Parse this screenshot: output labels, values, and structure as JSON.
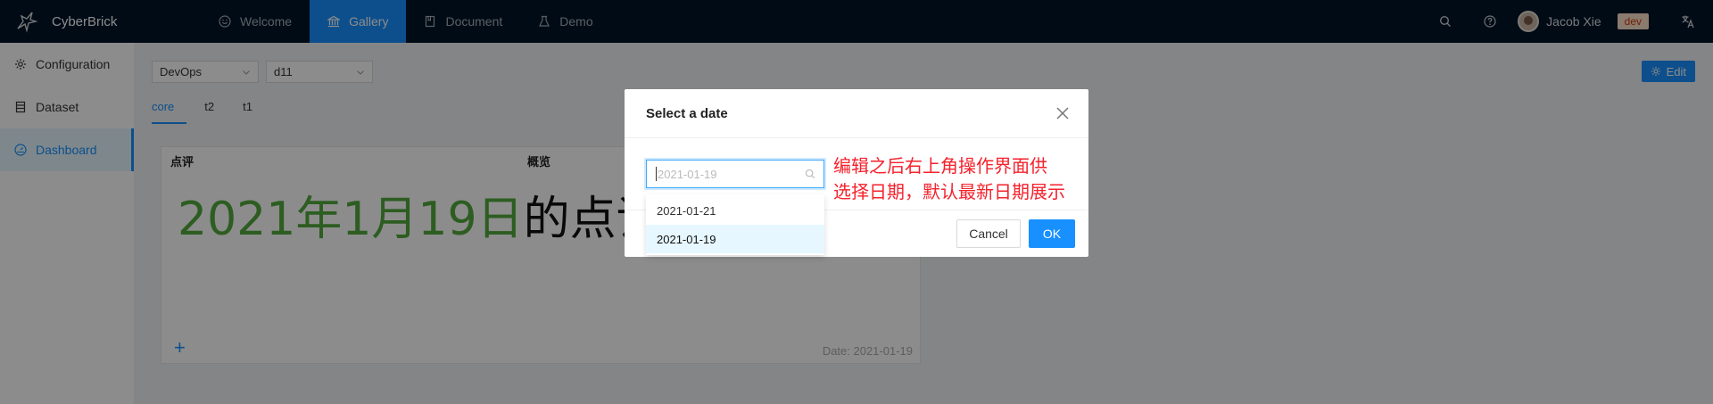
{
  "app": {
    "name": "CyberBrick"
  },
  "nav": {
    "items": [
      {
        "label": "Welcome",
        "icon": "smile-icon"
      },
      {
        "label": "Gallery",
        "icon": "bank-icon",
        "active": true
      },
      {
        "label": "Document",
        "icon": "book-icon"
      },
      {
        "label": "Demo",
        "icon": "flask-icon"
      }
    ]
  },
  "topright": {
    "user_name": "Jacob Xie",
    "env_badge": "dev"
  },
  "sidebar": {
    "items": [
      {
        "label": "Configuration",
        "icon": "settings-icon"
      },
      {
        "label": "Dataset",
        "icon": "database-icon"
      },
      {
        "label": "Dashboard",
        "icon": "dashboard-icon",
        "active": true
      }
    ]
  },
  "content": {
    "select_1": "DevOps",
    "select_2": "d11",
    "tabs": [
      {
        "label": "core",
        "active": true
      },
      {
        "label": "t2"
      },
      {
        "label": "t1"
      }
    ],
    "edit_label": "Edit",
    "card": {
      "col_1": "点评",
      "col_2": "概览",
      "text_green": "2021年1月19日",
      "text_dark": "的点评...",
      "plus": "+",
      "date": "Date: 2021-01-19"
    }
  },
  "modal": {
    "title": "Select a date",
    "input_placeholder": "2021-01-19",
    "annotation_line_1": "编辑之后右上角操作界面供",
    "annotation_line_2": "选择日期，默认最新日期展示",
    "cancel_label": "Cancel",
    "ok_label": "OK",
    "options": [
      "2021-01-21",
      "2021-01-19"
    ],
    "selected_option": "2021-01-19"
  },
  "colors": {
    "topbar": "#001529",
    "primary": "#1890ff",
    "green_text": "#52a93c",
    "annotation": "#f5222d"
  }
}
